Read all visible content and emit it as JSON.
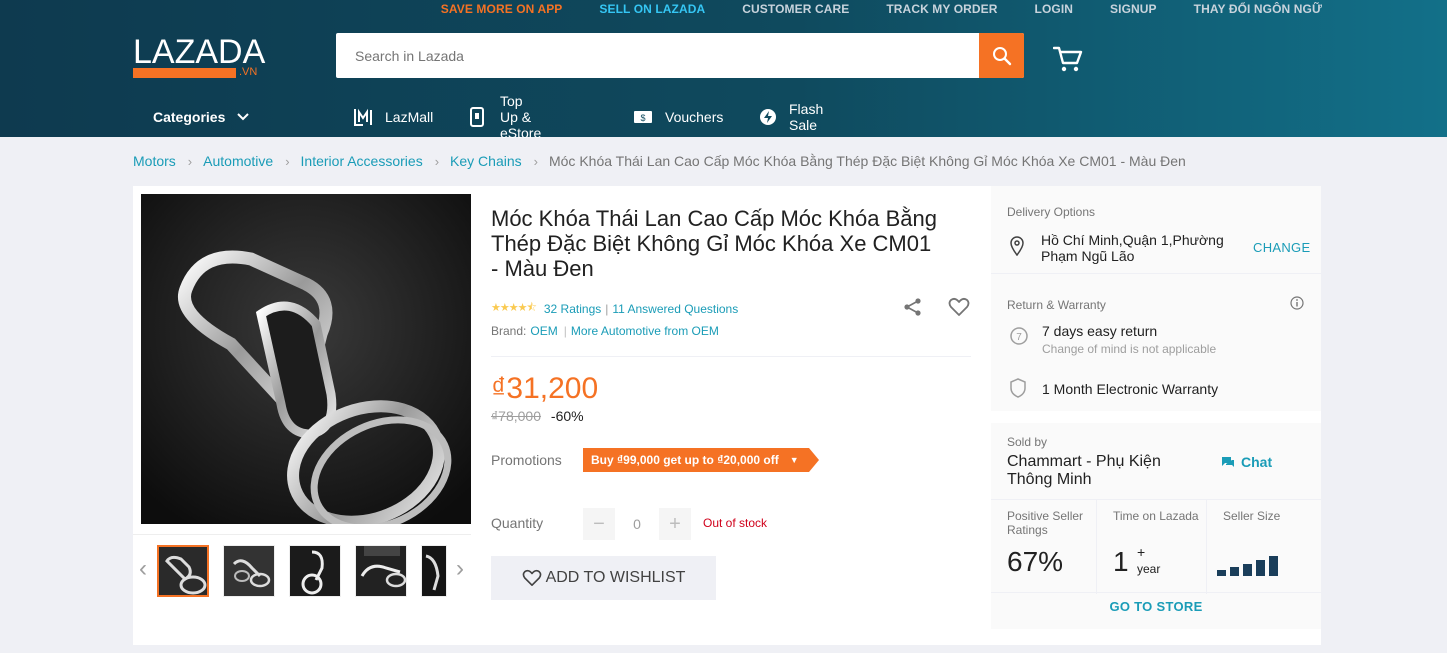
{
  "topbar": {
    "links": [
      "SAVE MORE ON APP",
      "SELL ON LAZADA",
      "CUSTOMER CARE",
      "TRACK MY ORDER",
      "LOGIN",
      "SIGNUP",
      "THAY ĐỔI NGÔN NGỮ"
    ]
  },
  "logo": {
    "word": "LAZADA",
    "suffix": ".VN"
  },
  "search": {
    "placeholder": "Search in Lazada",
    "value": ""
  },
  "nav": {
    "categories": "Categories",
    "items": [
      "LazMall",
      "Top Up & eStore",
      "Vouchers",
      "Flash Sale"
    ]
  },
  "breadcrumb": [
    "Motors",
    "Automotive",
    "Interior Accessories",
    "Key Chains"
  ],
  "breadcrumb_current": "Móc Khóa Thái Lan Cao Cấp Móc Khóa Bằng Thép Đặc Biệt Không Gỉ Móc Khóa Xe CM01 - Màu Đen",
  "product": {
    "title": "Móc Khóa Thái Lan Cao Cấp Móc Khóa Bằng Thép Đặc Biệt Không Gỉ Móc Khóa Xe CM01 - Màu Đen",
    "rating_stars": 4.5,
    "ratings": "32 Ratings",
    "answered": "11 Answered Questions",
    "brand_label": "Brand:",
    "brand": "OEM",
    "more_from": "More Automotive from OEM",
    "price": "₫31,200",
    "old_price": "₫78,000",
    "discount": "-60%",
    "promotions_label": "Promotions",
    "promotion": "Buy ₫99,000 get up to ₫20,000 off",
    "quantity_label": "Quantity",
    "quantity": "0",
    "stock_status": "Out of stock",
    "wishlist": "ADD TO WISHLIST"
  },
  "delivery": {
    "title": "Delivery Options",
    "address": "Hồ Chí Minh,Quận 1,Phường Phạm Ngũ Lão",
    "change": "CHANGE"
  },
  "warranty": {
    "title": "Return & Warranty",
    "return": "7 days easy return",
    "return_sub": "Change of mind is not applicable",
    "warranty": "1 Month Electronic Warranty"
  },
  "seller": {
    "sold_by": "Sold by",
    "name": "Chammart - Phụ Kiện Thông Minh",
    "chat": "Chat",
    "positive_label": "Positive Seller Ratings",
    "positive_value": "67%",
    "time_label": "Time on Lazada",
    "time_value": "1",
    "time_plus": "+",
    "time_unit": "year",
    "size_label": "Seller Size",
    "size_level": 4,
    "go_store": "GO TO STORE"
  },
  "colors": {
    "brand_orange": "#f57224",
    "link_blue": "#1a9cb7",
    "header_dark": "#0e3a4f",
    "out_of_stock_red": "#d0011b"
  }
}
